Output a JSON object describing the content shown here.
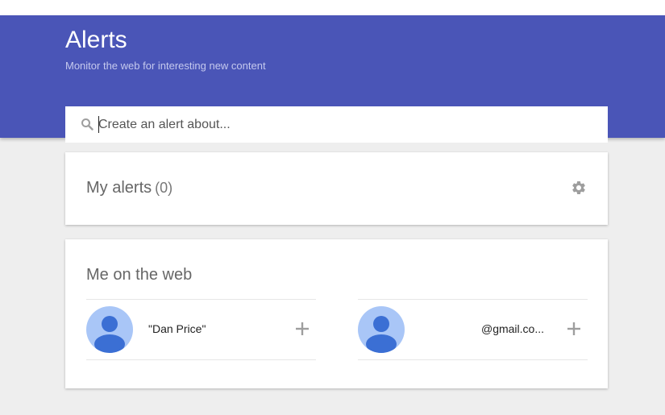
{
  "header": {
    "title": "Alerts",
    "subtitle": "Monitor the web for interesting new content",
    "color": "#4a55b7"
  },
  "search": {
    "placeholder": "Create an alert about...",
    "value": "",
    "icon": "search-icon"
  },
  "my_alerts": {
    "title": "My alerts",
    "count": "(0)",
    "settings_icon": "gear-icon"
  },
  "me_on_web": {
    "title": "Me on the web",
    "suggestions": [
      {
        "label": "\"Dan Price\"",
        "icon": "avatar",
        "action_icon": "plus-icon"
      },
      {
        "label": "@gmail.co...",
        "icon": "avatar",
        "action_icon": "plus-icon"
      }
    ]
  }
}
